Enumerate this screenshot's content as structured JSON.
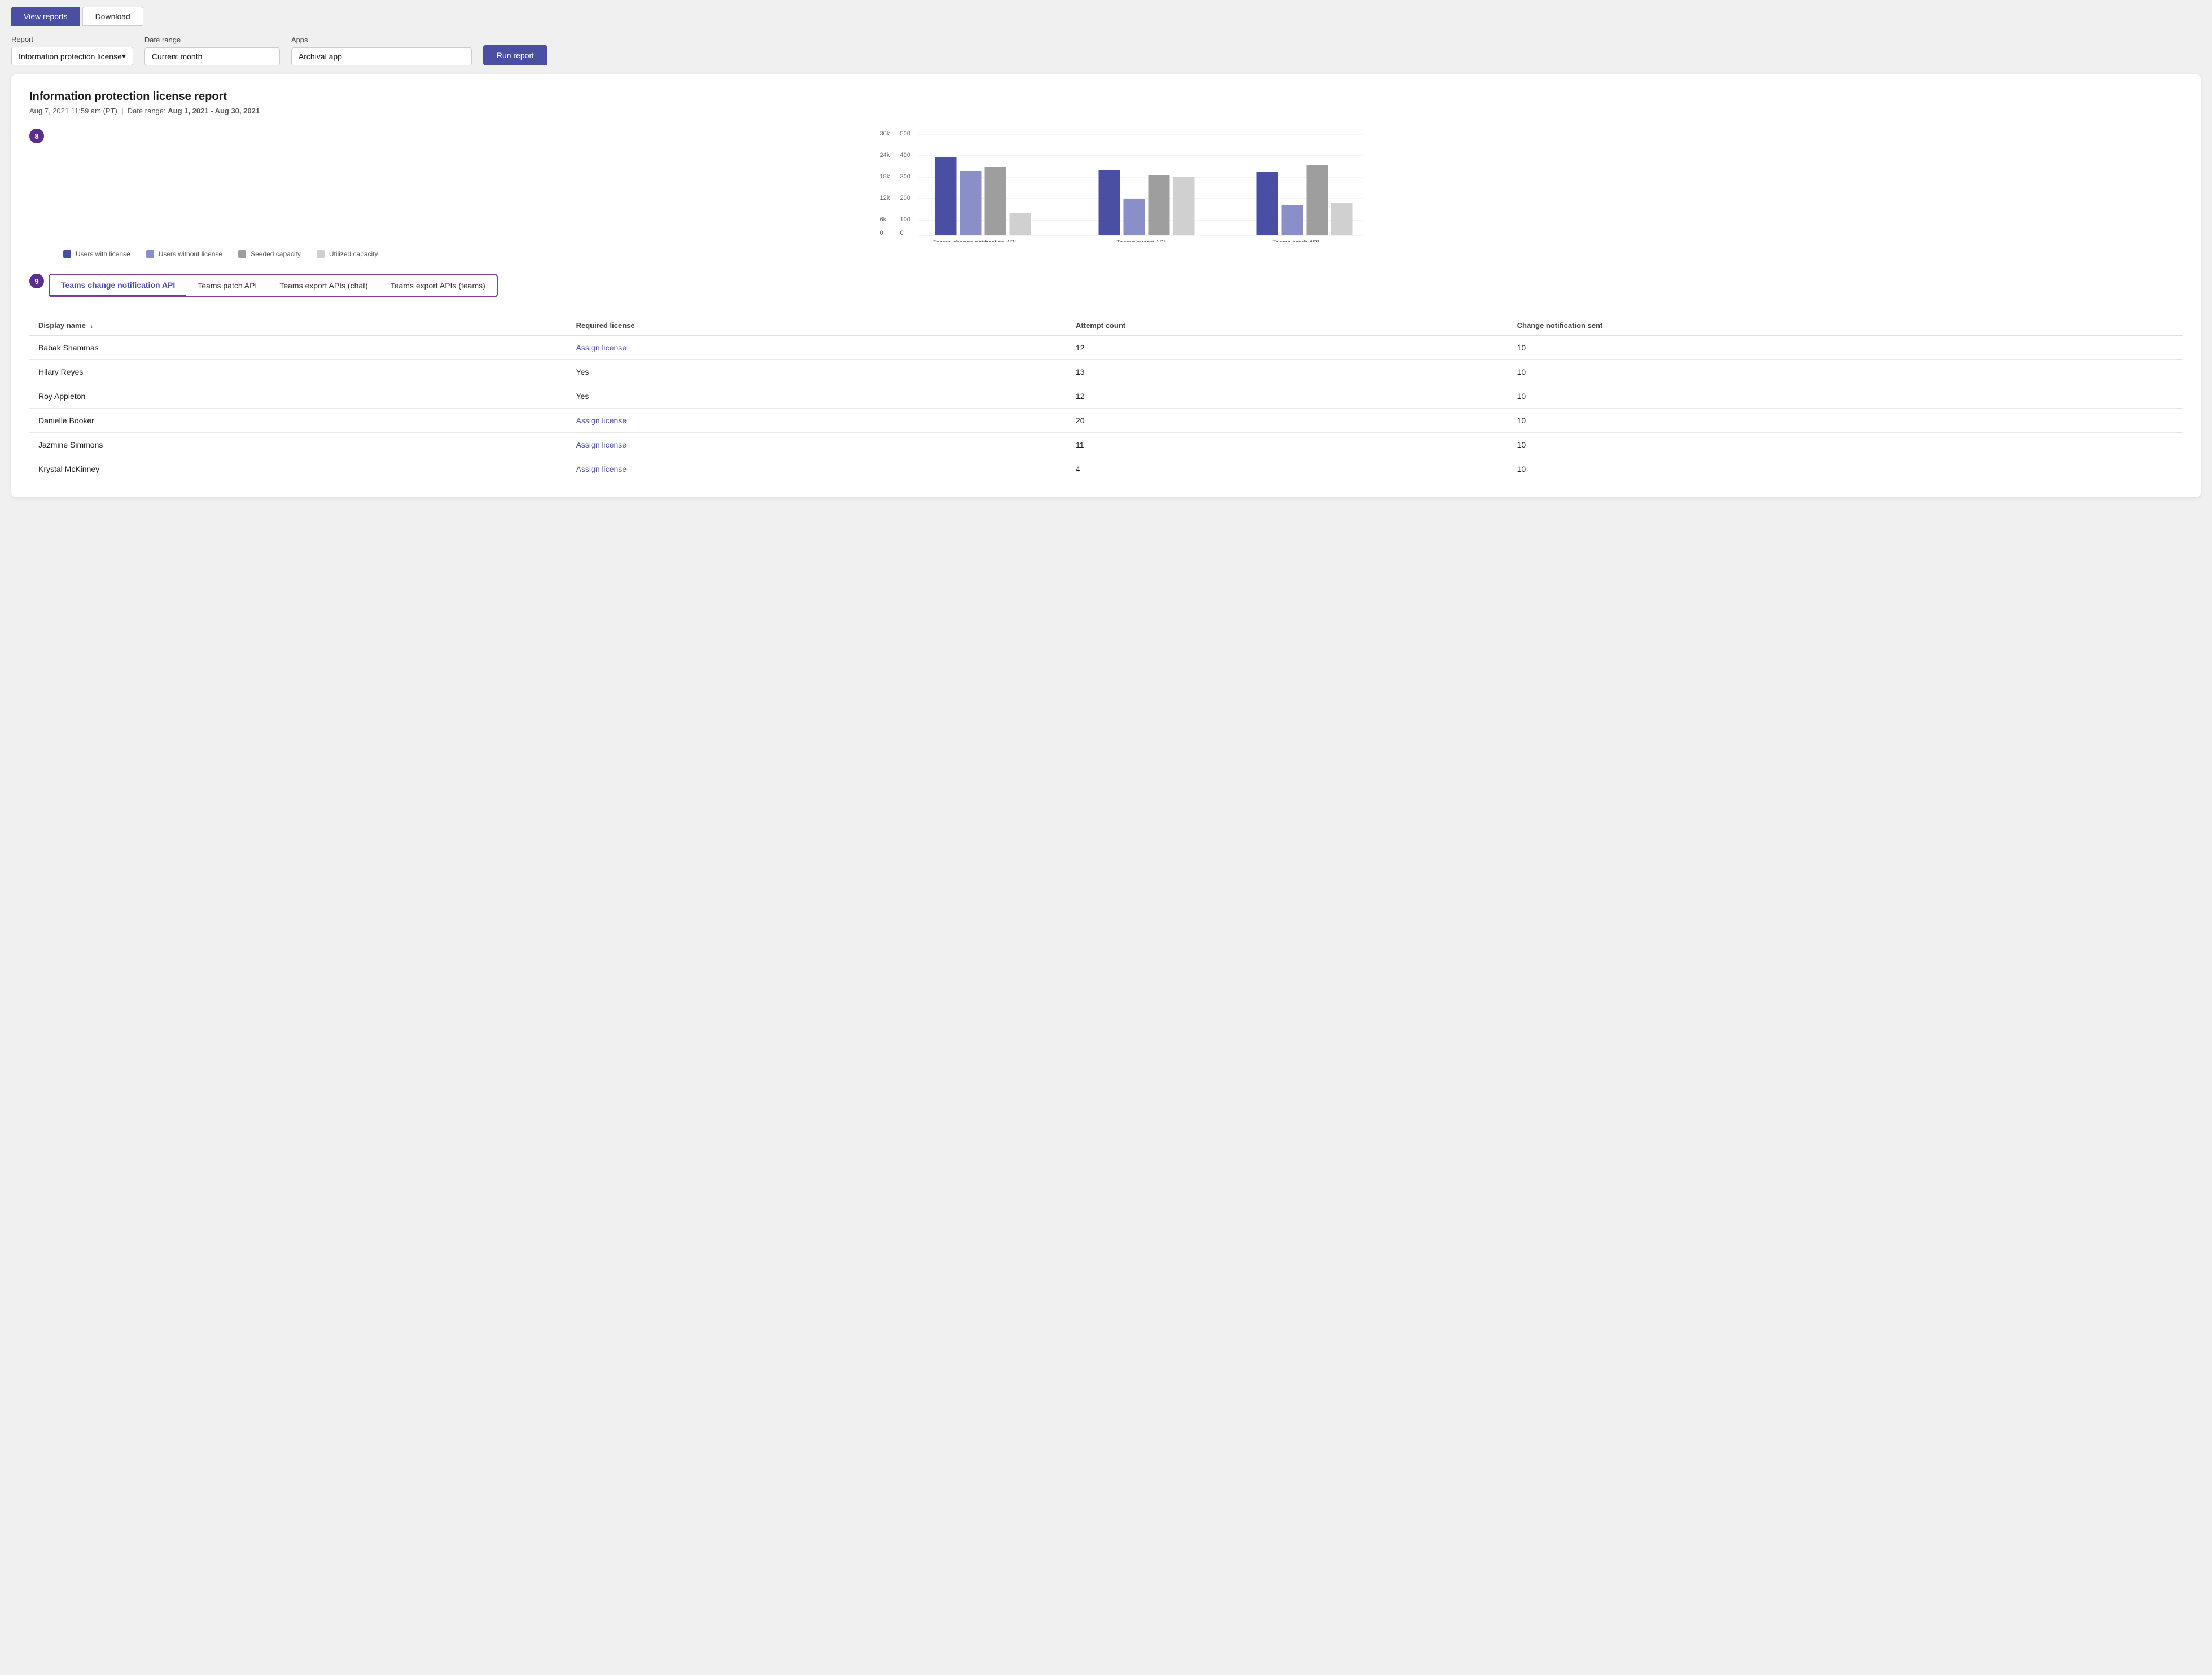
{
  "tabs": [
    {
      "label": "View reports",
      "active": true
    },
    {
      "label": "Download",
      "active": false
    }
  ],
  "filters": {
    "report_label": "Report",
    "report_value": "Information protection license",
    "date_range_label": "Date range",
    "date_range_value": "Current month",
    "apps_label": "Apps",
    "apps_value": "Archival app",
    "run_button": "Run report"
  },
  "report": {
    "title": "Information protection license report",
    "date_generated": "Aug 7, 2021 11:59 am (PT)",
    "date_range": "Aug 1, 2021 - Aug 30, 2021",
    "step8_number": "8",
    "step9_number": "9"
  },
  "chart": {
    "y_labels_left": [
      "30k",
      "24k",
      "18k",
      "12k",
      "6k",
      "0"
    ],
    "y_labels_right": [
      "500",
      "400",
      "300",
      "200",
      "100",
      "0"
    ],
    "groups": [
      {
        "label": "Teams change notification API"
      },
      {
        "label": "Teams export API\n(chat + teams)"
      },
      {
        "label": "Teams patch API"
      }
    ]
  },
  "legend": [
    {
      "label": "Users with license",
      "color": "#4a4fa3"
    },
    {
      "label": "Users without license",
      "color": "#8b8fc9"
    },
    {
      "label": "Seeded capacity",
      "color": "#9e9e9e"
    },
    {
      "label": "Utilized capacity",
      "color": "#d0d0d0"
    }
  ],
  "api_tabs": [
    {
      "label": "Teams change notification API",
      "active": true
    },
    {
      "label": "Teams patch API",
      "active": false
    },
    {
      "label": "Teams export APIs (chat)",
      "active": false
    },
    {
      "label": "Teams export APIs (teams)",
      "active": false
    }
  ],
  "table": {
    "columns": [
      {
        "label": "Display name",
        "sort": "↓"
      },
      {
        "label": "Required license"
      },
      {
        "label": "Attempt count"
      },
      {
        "label": "Change notification sent"
      }
    ],
    "rows": [
      {
        "name": "Babak Shammas",
        "license": "Assign license",
        "is_link": true,
        "attempts": "12",
        "sent": "10"
      },
      {
        "name": "Hilary Reyes",
        "license": "Yes",
        "is_link": false,
        "attempts": "13",
        "sent": "10"
      },
      {
        "name": "Roy Appleton",
        "license": "Yes",
        "is_link": false,
        "attempts": "12",
        "sent": "10"
      },
      {
        "name": "Danielle Booker",
        "license": "Assign license",
        "is_link": true,
        "attempts": "20",
        "sent": "10"
      },
      {
        "name": "Jazmine Simmons",
        "license": "Assign license",
        "is_link": true,
        "attempts": "11",
        "sent": "10"
      },
      {
        "name": "Krystal McKinney",
        "license": "Assign license",
        "is_link": true,
        "attempts": "4",
        "sent": "10"
      }
    ]
  }
}
